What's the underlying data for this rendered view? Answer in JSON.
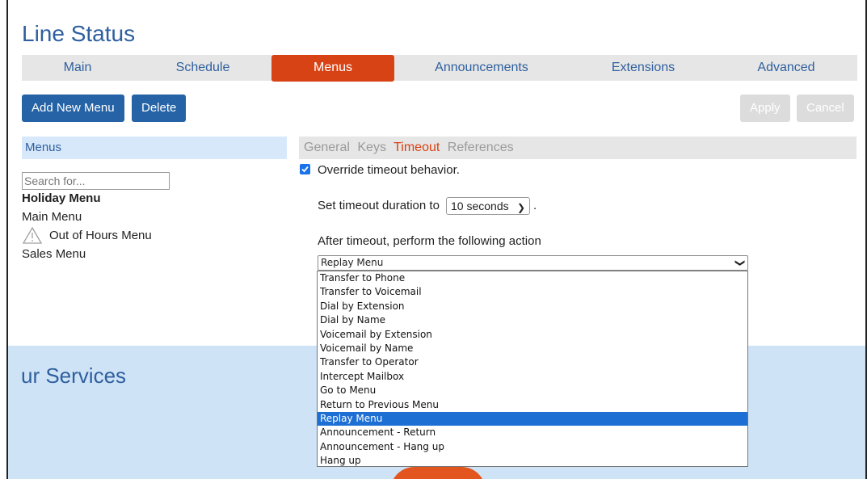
{
  "page": {
    "title": "Line Status"
  },
  "tabs": [
    {
      "label": "Main"
    },
    {
      "label": "Schedule"
    },
    {
      "label": "Menus"
    },
    {
      "label": "Announcements"
    },
    {
      "label": "Extensions"
    },
    {
      "label": "Advanced"
    }
  ],
  "toolbar": {
    "add_label": "Add New Menu",
    "delete_label": "Delete",
    "apply_label": "Apply",
    "cancel_label": "Cancel"
  },
  "sidebar": {
    "header": "Menus",
    "search_placeholder": "Search for...",
    "items": [
      {
        "label": "Holiday Menu"
      },
      {
        "label": "Main Menu"
      },
      {
        "label": "Out of Hours Menu"
      },
      {
        "label": "Sales Menu"
      }
    ]
  },
  "subtabs": [
    {
      "label": "General"
    },
    {
      "label": "Keys"
    },
    {
      "label": "Timeout"
    },
    {
      "label": "References"
    }
  ],
  "timeout": {
    "override_label": "Override timeout behavior.",
    "duration_label": "Set timeout duration to",
    "duration_value": "10 seconds",
    "duration_suffix": ".",
    "after_label": "After timeout, perform the following action",
    "action_value": "Replay Menu",
    "options": [
      "Transfer to Phone",
      "Transfer to Voicemail",
      "Dial by Extension",
      "Dial by Name",
      "Voicemail by Extension",
      "Voicemail by Name",
      "Transfer to Operator",
      "Intercept Mailbox",
      "Go to Menu",
      "Return to Previous Menu",
      "Replay Menu",
      "Announcement - Return",
      "Announcement - Hang up",
      "Hang up"
    ]
  },
  "background": {
    "services_title": "ur Services"
  },
  "colors": {
    "accent": "#d84315",
    "primary": "#2563a6",
    "title": "#2e5f9e",
    "selection": "#1e6fd4"
  }
}
